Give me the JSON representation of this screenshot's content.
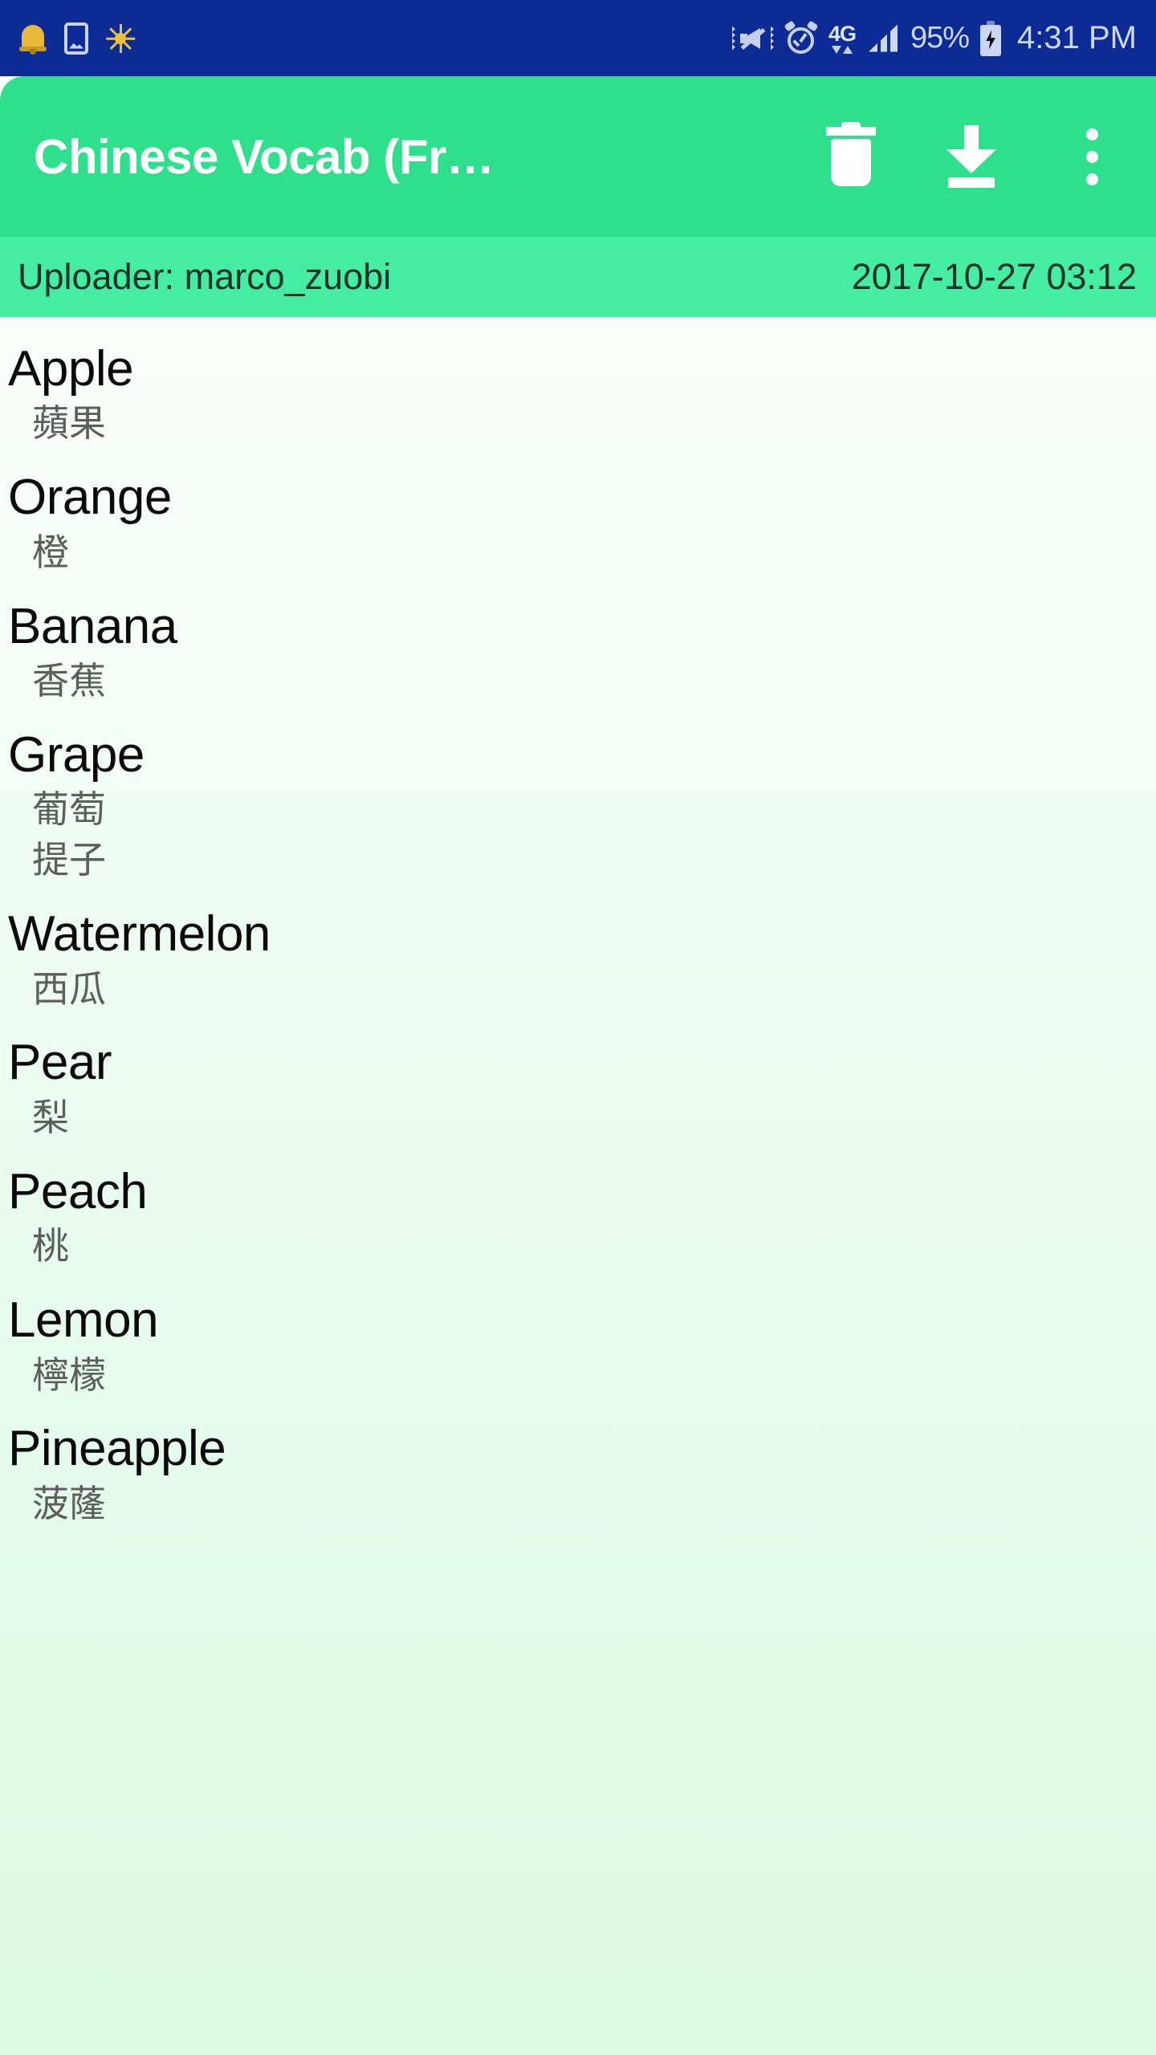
{
  "status_bar": {
    "icons_left": [
      "bell-icon",
      "screenshot-icon",
      "brightness-icon"
    ],
    "icons_right": [
      "mute-vibrate-icon",
      "alarm-icon",
      "4g-data-icon",
      "signal-icon"
    ],
    "network_label": "4G",
    "battery_percent": "95%",
    "battery_state": "charging-battery-icon",
    "time": "4:31 PM"
  },
  "app_bar": {
    "title": "Chinese Vocab (Fr…",
    "actions": [
      {
        "name": "delete-button",
        "icon": "trash-icon"
      },
      {
        "name": "download-button",
        "icon": "download-icon"
      },
      {
        "name": "overflow-menu-button",
        "icon": "more-vertical-icon"
      }
    ],
    "background_color": "#2ee08c"
  },
  "info_bar": {
    "uploader": "Uploader: marco_zuobi",
    "date": "2017-10-27 03:12",
    "background_color": "#45eda2"
  },
  "list": {
    "items": [
      {
        "term": "Apple",
        "translations": [
          "蘋果"
        ]
      },
      {
        "term": "Orange",
        "translations": [
          "橙"
        ]
      },
      {
        "term": "Banana",
        "translations": [
          "香蕉"
        ]
      },
      {
        "term": "Grape",
        "translations": [
          "葡萄",
          "提子"
        ]
      },
      {
        "term": "Watermelon",
        "translations": [
          "西瓜"
        ]
      },
      {
        "term": "Pear",
        "translations": [
          "梨"
        ]
      },
      {
        "term": "Peach",
        "translations": [
          "桃"
        ]
      },
      {
        "term": "Lemon",
        "translations": [
          "檸檬"
        ]
      },
      {
        "term": "Pineapple",
        "translations": [
          "菠蕯"
        ]
      }
    ]
  }
}
